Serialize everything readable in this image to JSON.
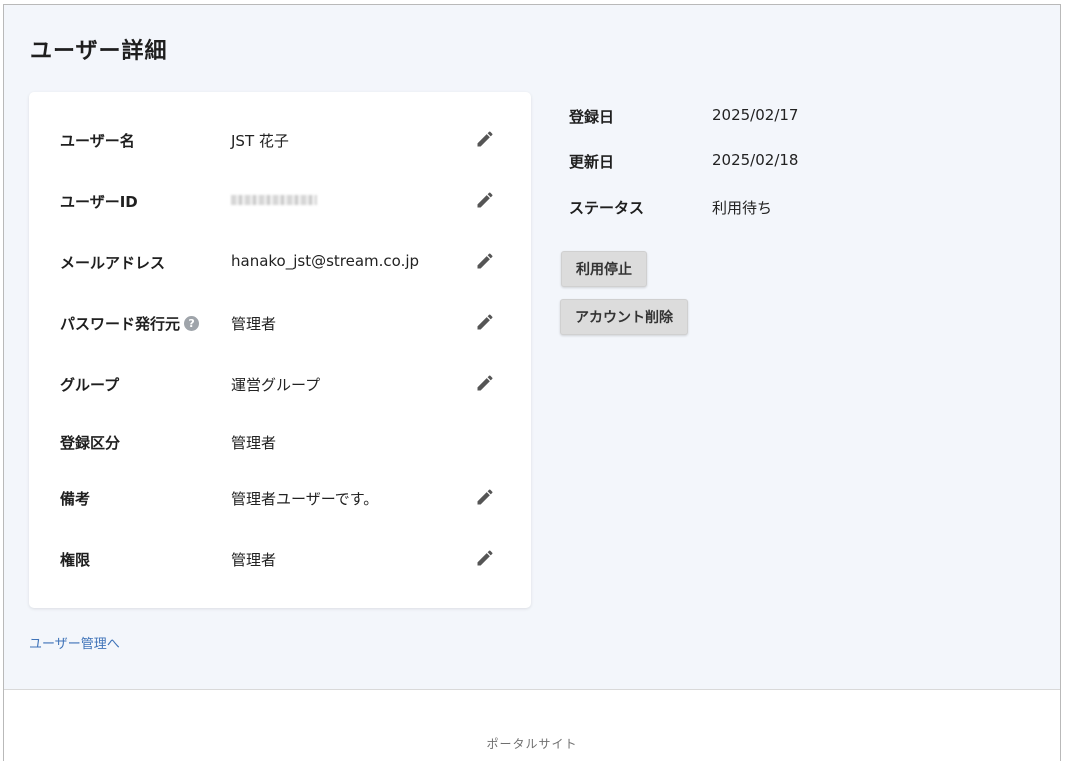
{
  "page": {
    "title": "ユーザー詳細"
  },
  "details": [
    {
      "label": "ユーザー名",
      "value": "JST 花子",
      "editable": true
    },
    {
      "label": "ユーザーID",
      "value": "",
      "masked": true,
      "editable": true
    },
    {
      "label": "メールアドレス",
      "value": "hanako_jst@stream.co.jp",
      "editable": true
    },
    {
      "label": "パスワード発行元",
      "value": "管理者",
      "help": "?",
      "editable": true
    },
    {
      "label": "グループ",
      "value": "運営グループ",
      "editable": true
    },
    {
      "label": "登録区分",
      "value": "管理者",
      "editable": false
    },
    {
      "label": "備考",
      "value": "管理者ユーザーです。",
      "editable": true
    },
    {
      "label": "権限",
      "value": "管理者",
      "editable": true
    }
  ],
  "meta": [
    {
      "label": "登録日",
      "value": "2025/02/17"
    },
    {
      "label": "更新日",
      "value": "2025/02/18"
    },
    {
      "label": "ステータス",
      "value": "利用待ち"
    }
  ],
  "actions": {
    "suspend_label": "利用停止",
    "delete_label": "アカウント削除"
  },
  "back_link": "ユーザー管理へ",
  "footer": {
    "text": "ポータルサイト"
  },
  "icons": {
    "edit": "pencil-icon",
    "help": "question-circle-icon"
  }
}
